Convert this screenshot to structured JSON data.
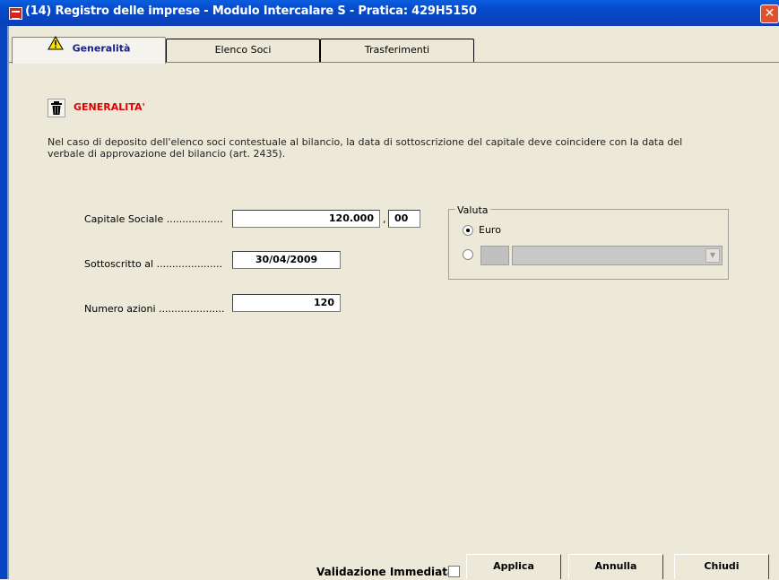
{
  "window": {
    "title": "(14) Registro delle imprese - Modulo Intercalare S - Pratica: 429H5150",
    "close_glyph": "✕"
  },
  "tabs": [
    {
      "label": "Generalità"
    },
    {
      "label": "Elenco Soci"
    },
    {
      "label": "Trasferimenti"
    }
  ],
  "section": {
    "title": "GENERALITA'",
    "note": "Nel caso di deposito dell'elenco soci contestuale al bilancio, la data di sottoscrizione del capitale deve coincidere con la data del verbale di approvazione del bilancio (art. 2435)."
  },
  "form": {
    "capitale_label": "Capitale Sociale ..................",
    "capitale_value": "120.000",
    "capitale_comma": ",",
    "capitale_decimals": "00",
    "sottoscritto_label": "Sottoscritto al .....................",
    "sottoscritto_value": "30/04/2009",
    "azioni_label": "Numero azioni .....................",
    "azioni_value": "120"
  },
  "valuta": {
    "title": "Valuta",
    "option_euro": "Euro",
    "selected": "Euro"
  },
  "footer": {
    "validazione_label": "Validazione Immediata",
    "validazione_checked": false,
    "buttons": [
      {
        "label": "Applica"
      },
      {
        "label": "Annulla"
      },
      {
        "label": "Chiudi"
      }
    ]
  }
}
